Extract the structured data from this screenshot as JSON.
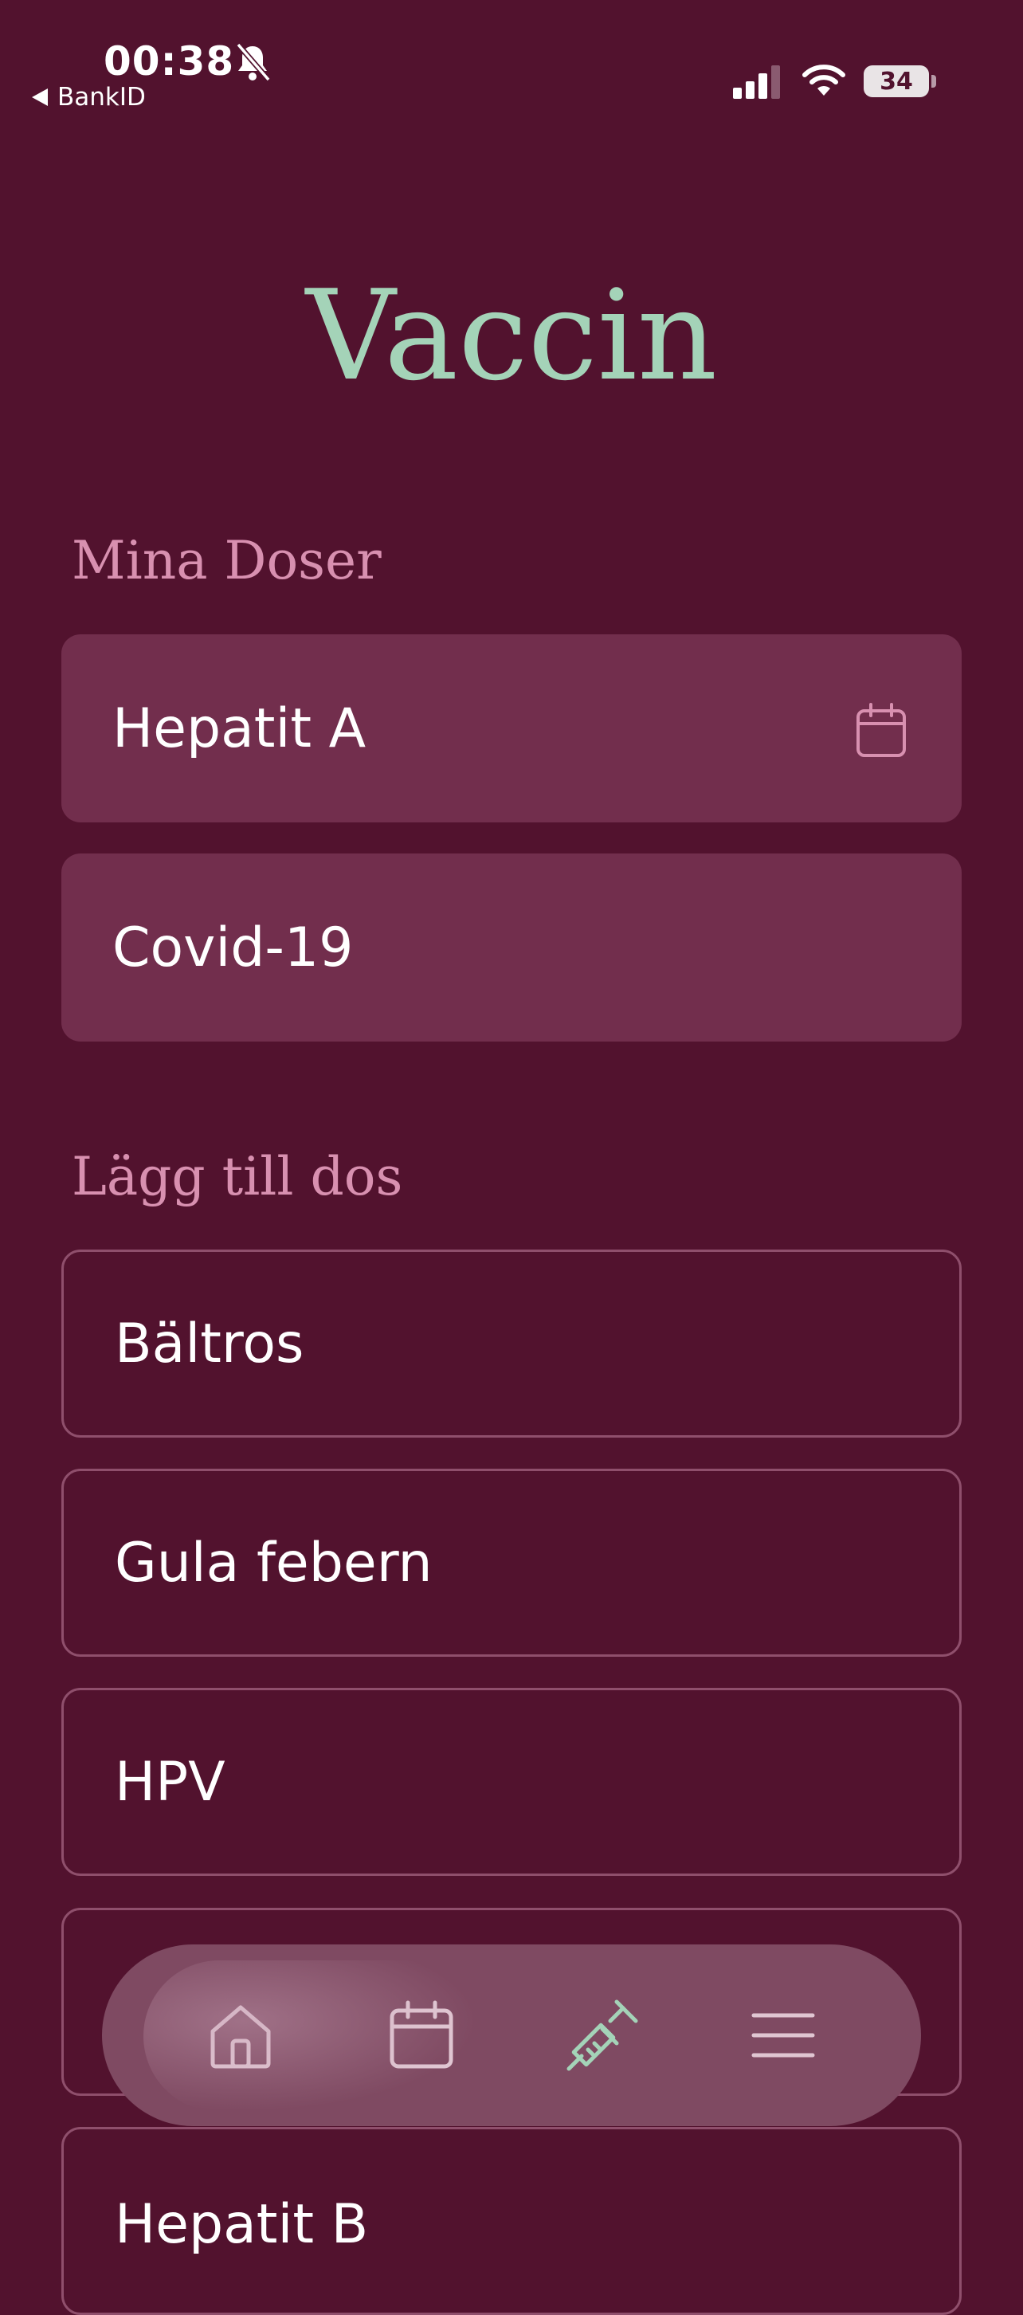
{
  "status_bar": {
    "time": "00:38",
    "back_app": "BankID",
    "battery": "34"
  },
  "page": {
    "title": "Vaccin"
  },
  "my_doses": {
    "title": "Mina Doser",
    "items": [
      {
        "label": "Hepatit A",
        "icon": "calendar-icon"
      },
      {
        "label": "Covid-19"
      }
    ]
  },
  "add_dose": {
    "title": "Lägg till dos",
    "items": [
      {
        "label": "Bältros"
      },
      {
        "label": "Gula febern"
      },
      {
        "label": "HPV"
      },
      {
        "label": ""
      },
      {
        "label": "Hepatit B"
      }
    ]
  },
  "bottom_nav": {
    "items": [
      {
        "icon": "home-icon"
      },
      {
        "icon": "calendar-icon"
      },
      {
        "icon": "syringe-icon",
        "active": true
      },
      {
        "icon": "menu-icon"
      }
    ]
  },
  "colors": {
    "background": "#52122e",
    "card_filled": "#722e4d",
    "title": "#a4d3b8",
    "section": "#d890b0",
    "nav": "#7f4a62"
  }
}
